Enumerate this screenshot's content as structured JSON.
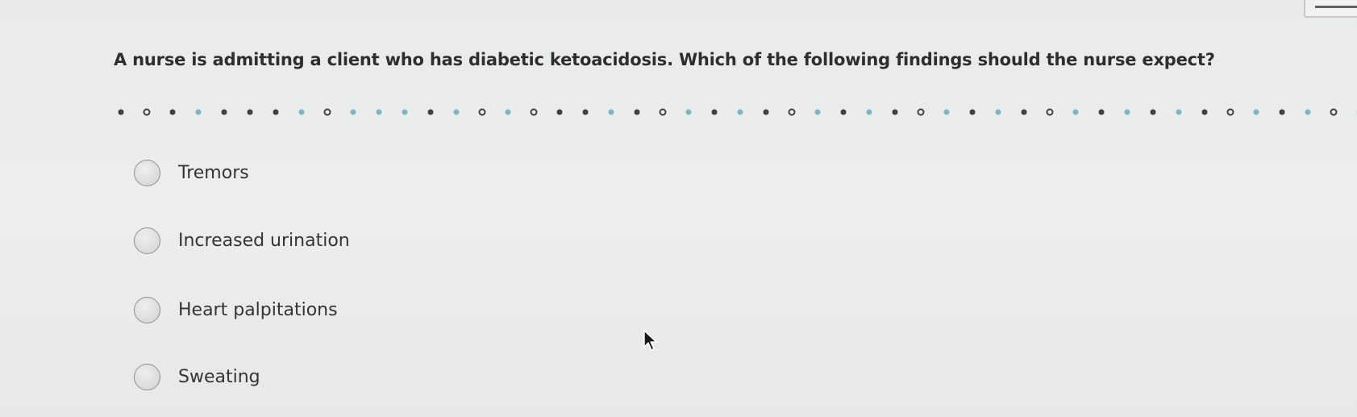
{
  "question": {
    "text": "A nurse is admitting a client who has diabetic ketoacidosis. Which of the following findings should the nurse expect?"
  },
  "progress": {
    "markers": [
      "filled",
      "open",
      "filled",
      "teal",
      "filled",
      "filled",
      "filled",
      "teal",
      "open",
      "teal",
      "teal",
      "teal",
      "filled",
      "teal",
      "open",
      "teal",
      "open",
      "filled",
      "filled",
      "teal",
      "filled",
      "open",
      "teal",
      "filled",
      "teal",
      "filled",
      "open",
      "teal",
      "filled",
      "teal",
      "filled",
      "open",
      "teal",
      "filled",
      "teal",
      "filled",
      "open",
      "teal",
      "filled",
      "teal",
      "filled",
      "teal",
      "filled",
      "open",
      "teal",
      "filled",
      "teal",
      "open",
      "teal"
    ]
  },
  "options": [
    {
      "label": "Tremors"
    },
    {
      "label": "Increased urination"
    },
    {
      "label": "Heart palpitations"
    },
    {
      "label": "Sweating"
    }
  ],
  "colors": {
    "background": "#eaeceb",
    "question_text": "#2e2e2e",
    "dot_filled": "#3d3f41",
    "dot_teal": "#7fb6bd",
    "radio_border": "#8d9092"
  },
  "icons": {
    "cursor": "mouse-pointer-icon",
    "radio": "radio-button-icon"
  }
}
